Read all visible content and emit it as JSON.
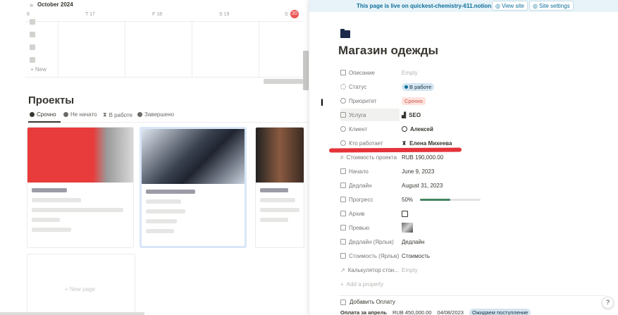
{
  "calendar": {
    "month": "October 2024",
    "days": [
      {
        "label": "6"
      },
      {
        "label": "T 17"
      },
      {
        "label": "F 18"
      },
      {
        "label": "S 19"
      },
      {
        "label": "S",
        "today": "20"
      }
    ],
    "new_label": "New"
  },
  "projects": {
    "title": "Проекты",
    "tabs": [
      {
        "label": "Срочно",
        "active": true
      },
      {
        "label": "Не начато"
      },
      {
        "label": "В работе"
      },
      {
        "label": "Завершено"
      }
    ],
    "new_page_label": "New page"
  },
  "banner": {
    "message": "This page is live on quickest-chemistry-611.notion.site",
    "view_site": "View site",
    "site_settings": "Site settings"
  },
  "page": {
    "title": "Магазин одежды",
    "properties": [
      {
        "name": "Описание",
        "value": "Empty",
        "empty": true
      },
      {
        "name": "Статус",
        "value": "В работе",
        "type": "status"
      },
      {
        "name": "Приоритет",
        "value": "Срочно",
        "type": "priority"
      },
      {
        "name": "Услуга",
        "value": "SEO",
        "type": "relation"
      },
      {
        "name": "Клиент",
        "value": "Алексей",
        "type": "person"
      },
      {
        "name": "Кто работает",
        "value": "Елена Михеева",
        "type": "person"
      },
      {
        "name": "Стоимость проекта",
        "value": "RUB 190,000.00"
      },
      {
        "name": "Начало",
        "value": "June 9, 2023"
      },
      {
        "name": "Дедлайн",
        "value": "August 31, 2023"
      },
      {
        "name": "Прогресс",
        "value": "50%",
        "type": "progress",
        "progress": 0.5
      },
      {
        "name": "Архив",
        "value": "",
        "type": "checkbox"
      },
      {
        "name": "Превью",
        "value": "",
        "type": "image"
      },
      {
        "name": "Дедлайн (Ярлык)",
        "value": "Дедлайн"
      },
      {
        "name": "Стоимость (Ярлык)",
        "value": "Стоимость"
      },
      {
        "name": "Калькулятор стои...",
        "value": "Empty",
        "empty": true
      }
    ],
    "add_property": "Add a property",
    "add_payment": "Добавить Оплату",
    "payment_row": {
      "title": "Оплата за апрель",
      "amount": "RUB 450,000.00",
      "date": "04/08/2023",
      "status": "Ожидаем поступление"
    }
  },
  "colors": {
    "accent": "#0b6e99",
    "banner_bg": "#e7f3f8",
    "annotation_red": "#e5333b",
    "progress_green": "#448361"
  }
}
